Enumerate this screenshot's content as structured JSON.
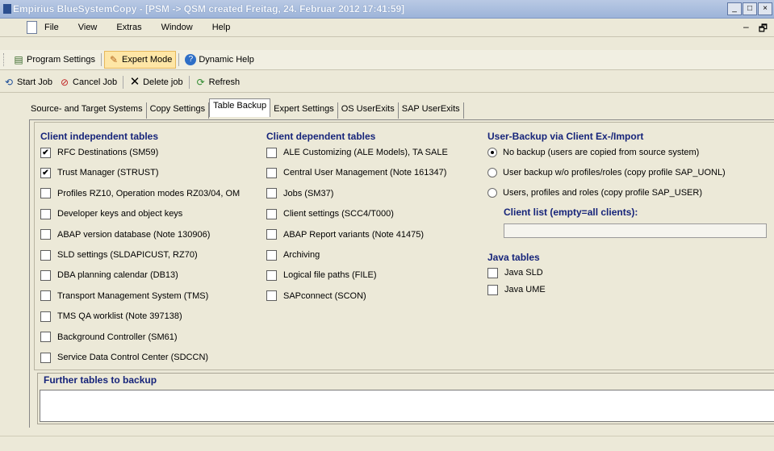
{
  "window": {
    "title": "Empirius BlueSystemCopy - [PSM -> QSM created Freitag, 24. Februar 2012 17:41:59]",
    "controls": [
      "_",
      "□",
      "×"
    ],
    "mdi_controls": [
      "–",
      "🗗"
    ]
  },
  "menu": [
    "File",
    "View",
    "Extras",
    "Window",
    "Help"
  ],
  "toolbar1": {
    "program_settings": "Program Settings",
    "expert_mode": "Expert Mode",
    "dynamic_help": "Dynamic Help"
  },
  "toolbar2": {
    "start_job": "Start Job",
    "cancel_job": "Cancel Job",
    "delete_job": "Delete job",
    "refresh": "Refresh"
  },
  "tabs": [
    "Source- and Target Systems",
    "Copy Settings",
    "Table Backup",
    "Expert Settings",
    "OS UserExits",
    "SAP UserExits"
  ],
  "selected_tab": "Table Backup",
  "client_independent": {
    "title": "Client independent tables",
    "items": [
      {
        "label": "RFC Destinations (SM59)",
        "checked": true
      },
      {
        "label": "Trust Manager (STRUST)",
        "checked": true
      },
      {
        "label": "Profiles RZ10, Operation modes RZ03/04, OM",
        "checked": false
      },
      {
        "label": "Developer keys and object keys",
        "checked": false
      },
      {
        "label": "ABAP version database (Note 130906)",
        "checked": false
      },
      {
        "label": "SLD settings (SLDAPICUST, RZ70)",
        "checked": false
      },
      {
        "label": "DBA planning calendar (DB13)",
        "checked": false
      },
      {
        "label": "Transport Management System (TMS)",
        "checked": false
      },
      {
        "label": "TMS QA worklist (Note 397138)",
        "checked": false
      },
      {
        "label": "Background Controller (SM61)",
        "checked": false
      },
      {
        "label": "Service Data Control Center (SDCCN)",
        "checked": false
      }
    ]
  },
  "client_dependent": {
    "title": "Client dependent tables",
    "items": [
      {
        "label": "ALE Customizing (ALE Models), TA SALE",
        "checked": false
      },
      {
        "label": "Central User Management (Note 161347)",
        "checked": false
      },
      {
        "label": "Jobs (SM37)",
        "checked": false
      },
      {
        "label": "Client settings (SCC4/T000)",
        "checked": false
      },
      {
        "label": "ABAP Report variants (Note 41475)",
        "checked": false
      },
      {
        "label": "Archiving",
        "checked": false
      },
      {
        "label": "Logical file paths (FILE)",
        "checked": false
      },
      {
        "label": "SAPconnect (SCON)",
        "checked": false
      }
    ]
  },
  "user_backup": {
    "title": "User-Backup via Client Ex-/Import",
    "options": [
      {
        "label": "No backup (users are copied from source system)",
        "selected": true
      },
      {
        "label": "User backup w/o profiles/roles (copy profile SAP_UONL)",
        "selected": false
      },
      {
        "label": "Users, profiles and roles (copy profile SAP_USER)",
        "selected": false
      }
    ],
    "client_list_label": "Client list (empty=all clients):",
    "client_list_value": ""
  },
  "java_tables": {
    "title": "Java tables",
    "items": [
      {
        "label": "Java SLD",
        "checked": false
      },
      {
        "label": "Java UME",
        "checked": false
      }
    ]
  },
  "further": {
    "title": "Further tables to backup",
    "value": ""
  },
  "colors": {
    "heading": "#16247a",
    "titlebar_text": "#f4f7fc"
  }
}
